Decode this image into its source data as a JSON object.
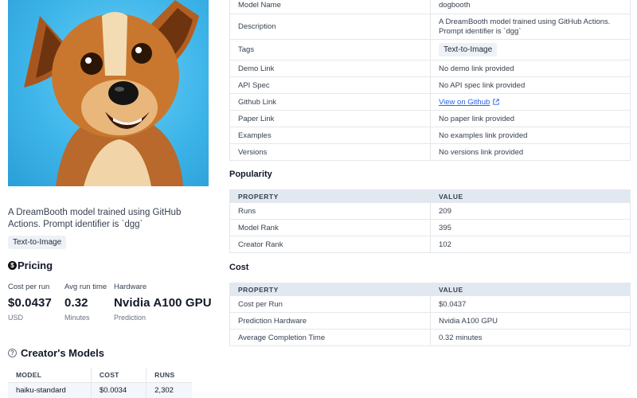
{
  "hero": {
    "alt": "A DreamBooth model trained using GitHub Actions"
  },
  "left": {
    "description": "A DreamBooth model trained using GitHub Actions. Prompt identifier is `dgg`",
    "tag": "Text-to-Image",
    "pricing_heading": "Pricing",
    "stats": [
      {
        "label": "Cost per run",
        "value": "$0.0437",
        "sub": "USD"
      },
      {
        "label": "Avg run time",
        "value": "0.32",
        "sub": "Minutes"
      },
      {
        "label": "Hardware",
        "value": "Nvidia A100 GPU",
        "sub": "Prediction"
      }
    ],
    "creators_heading": "Creator's Models",
    "creators_table": {
      "headers": [
        "MODEL",
        "COST",
        "RUNS"
      ],
      "rows": [
        [
          "haiku-standard",
          "$0.0034",
          "2,302"
        ]
      ]
    }
  },
  "details": {
    "rows": [
      {
        "label": "Model Name",
        "value": "dogbooth"
      },
      {
        "label": "Description",
        "value": "A DreamBooth model trained using GitHub Actions. Prompt identifier is `dgg`"
      },
      {
        "label": "Tags",
        "value": "Text-to-Image"
      },
      {
        "label": "Demo Link",
        "value": "No demo link provided"
      },
      {
        "label": "API Spec",
        "value": "No API spec link provided"
      },
      {
        "label": "Github Link",
        "value": "View on Github"
      },
      {
        "label": "Paper Link",
        "value": "No paper link provided"
      },
      {
        "label": "Examples",
        "value": "No examples link provided"
      },
      {
        "label": "Versions",
        "value": "No versions link provided"
      }
    ]
  },
  "popularity": {
    "heading": "Popularity",
    "headers": [
      "PROPERTY",
      "VALUE"
    ],
    "rows": [
      {
        "label": "Runs",
        "value": "209"
      },
      {
        "label": "Model Rank",
        "value": "395"
      },
      {
        "label": "Creator Rank",
        "value": "102"
      }
    ]
  },
  "cost": {
    "heading": "Cost",
    "headers": [
      "PROPERTY",
      "VALUE"
    ],
    "rows": [
      {
        "label": "Cost per Run",
        "value": "$0.0437"
      },
      {
        "label": "Prediction Hardware",
        "value": "Nvidia A100 GPU"
      },
      {
        "label": "Average Completion Time",
        "value": "0.32 minutes"
      }
    ]
  },
  "colors": {
    "link": "#2563eb",
    "header_bg": "#e2e8f0",
    "tag_bg": "#eef2f6",
    "hero_bg": "#3fb6ea"
  }
}
